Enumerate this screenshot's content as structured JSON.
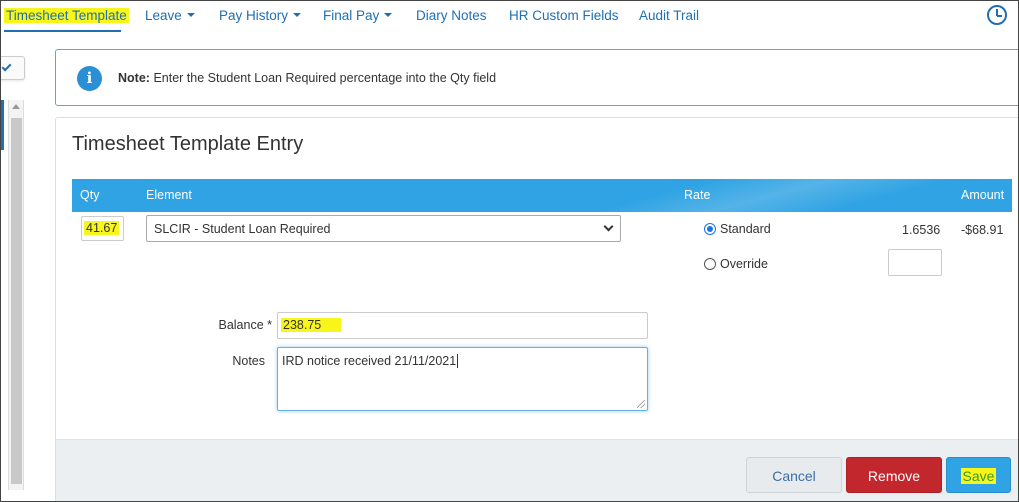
{
  "nav": {
    "items": [
      {
        "label": "Timesheet Template",
        "dropdown": false,
        "active": true
      },
      {
        "label": "Leave",
        "dropdown": true
      },
      {
        "label": "Pay History",
        "dropdown": true
      },
      {
        "label": "Final Pay",
        "dropdown": true
      },
      {
        "label": "Diary Notes",
        "dropdown": false
      },
      {
        "label": "HR Custom Fields",
        "dropdown": false
      },
      {
        "label": "Audit Trail",
        "dropdown": false
      }
    ]
  },
  "note": {
    "prefix": "Note:",
    "text": "Enter the Student Loan Required percentage into the Qty field"
  },
  "panel": {
    "title": "Timesheet Template Entry",
    "columns": {
      "qty": "Qty",
      "element": "Element",
      "rate": "Rate",
      "amount": "Amount"
    },
    "row": {
      "qty": "41.67",
      "element": "SLCIR - Student Loan Required",
      "rate_options": {
        "standard": "Standard",
        "override": "Override"
      },
      "selected_rate": "standard",
      "standard_rate": "1.6536",
      "amount": "-$68.91",
      "override_value": ""
    },
    "balance": {
      "label": "Balance *",
      "value": "238.75"
    },
    "notes": {
      "label": "Notes",
      "value": "IRD notice received 21/11/2021"
    }
  },
  "buttons": {
    "cancel": "Cancel",
    "remove": "Remove",
    "save": "Save"
  },
  "colors": {
    "accent": "#2fa3e3",
    "danger": "#c2272d",
    "highlight": "#f8f51b",
    "link": "#1f6fb2"
  }
}
